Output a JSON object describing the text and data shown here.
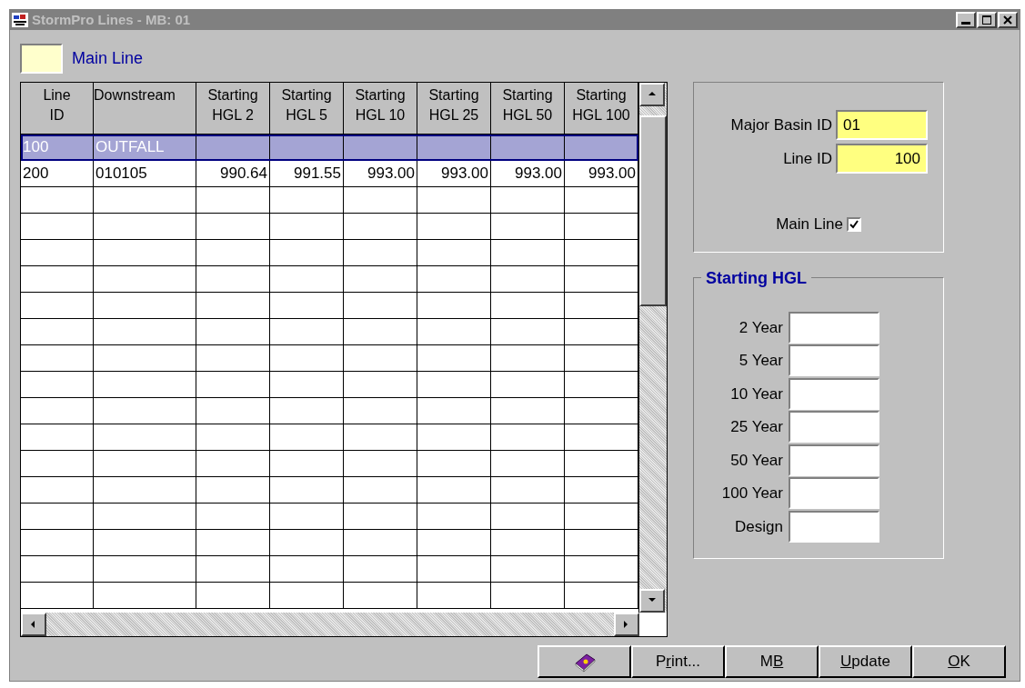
{
  "window": {
    "title": "StormPro Lines - MB: 01",
    "active": false
  },
  "legend": {
    "label": "Main Line",
    "color": "#ffffcc"
  },
  "table": {
    "columns": [
      {
        "lines": [
          "Line",
          "ID"
        ]
      },
      {
        "lines": [
          "Downstream"
        ]
      },
      {
        "lines": [
          "Starting",
          "HGL 2"
        ]
      },
      {
        "lines": [
          "Starting",
          "HGL 5"
        ]
      },
      {
        "lines": [
          "Starting",
          "HGL 10"
        ]
      },
      {
        "lines": [
          "Starting",
          "HGL 25"
        ]
      },
      {
        "lines": [
          "Starting",
          "HGL 50"
        ]
      },
      {
        "lines": [
          "Starting",
          "HGL 100"
        ]
      }
    ],
    "rows": [
      {
        "selected": true,
        "cells": [
          "100",
          "OUTFALL",
          "",
          "",
          "",
          "",
          "",
          ""
        ]
      },
      {
        "selected": false,
        "cells": [
          "200",
          "010105",
          "990.64",
          "991.55",
          "993.00",
          "993.00",
          "993.00",
          "993.00"
        ]
      }
    ]
  },
  "details": {
    "fields": [
      {
        "label": "Major Basin ID",
        "value": "01"
      },
      {
        "label": "Line ID",
        "value": "100"
      }
    ],
    "main_line": {
      "label": "Main Line",
      "checked": true
    }
  },
  "starting_hgl": {
    "title": "Starting HGL",
    "fields": [
      {
        "label": "2 Year"
      },
      {
        "label": "5 Year"
      },
      {
        "label": "10 Year"
      },
      {
        "label": "25 Year"
      },
      {
        "label": "50 Year"
      },
      {
        "label": "100 Year"
      },
      {
        "label": "Design"
      }
    ]
  },
  "buttons": [
    {
      "kind": "help"
    },
    {
      "kind": "text",
      "before": "P",
      "accel": "r",
      "after": "int..."
    },
    {
      "kind": "text",
      "before": "M",
      "accel": "B"
    },
    {
      "kind": "text",
      "accel": "U",
      "after": "pdate"
    },
    {
      "kind": "text",
      "accel": "O",
      "after": "K"
    }
  ]
}
